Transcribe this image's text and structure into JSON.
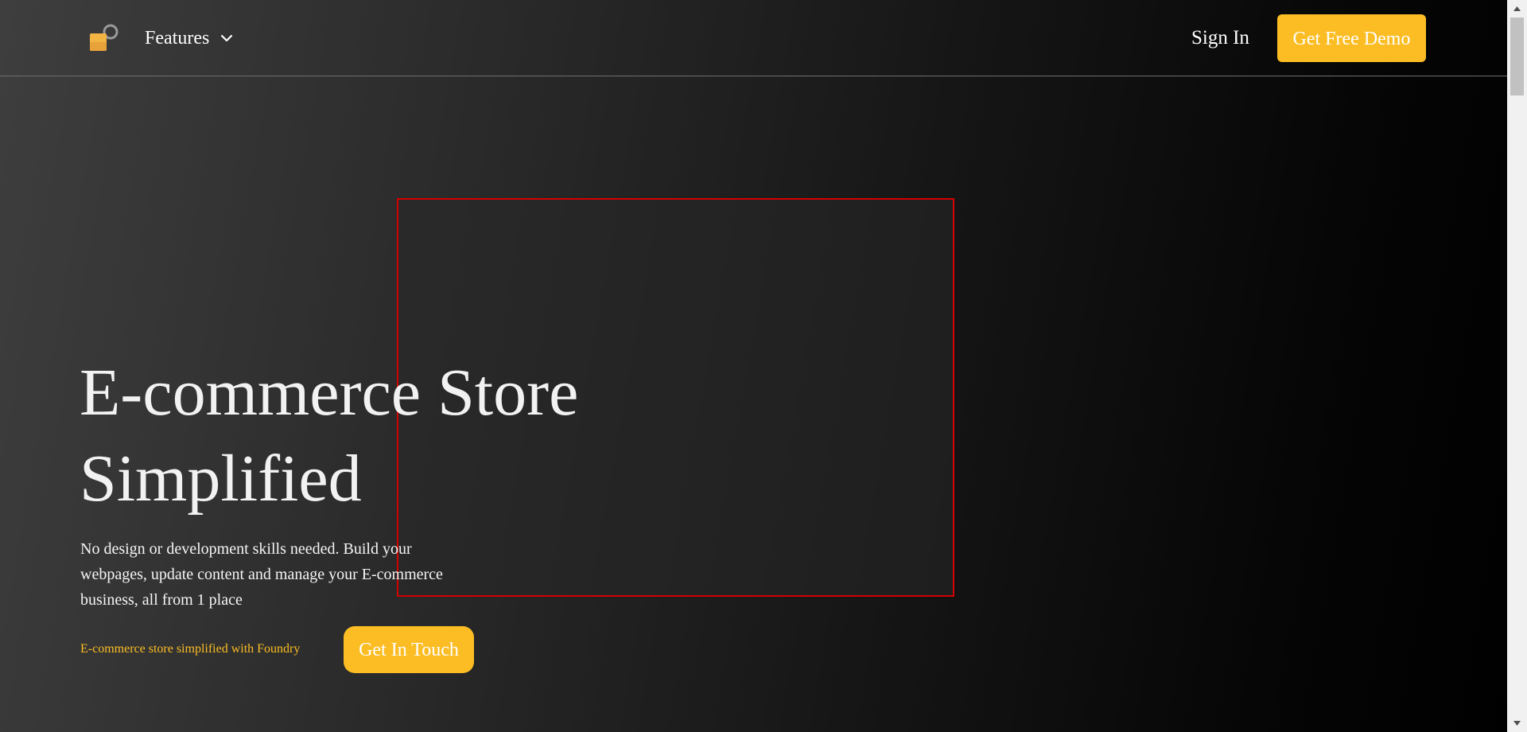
{
  "header": {
    "logo_icon": "lock-key-icon",
    "nav_features_label": "Features",
    "nav_features_icon": "chevron-down-icon",
    "signin_label": "Sign In",
    "demo_button_label": "Get Free Demo"
  },
  "hero": {
    "title": "E-commerce Store Simplified",
    "description": "No design or development skills needed. Build your webpages, update content and manage your E-commerce business, all from 1 place",
    "tagline": "E-commerce store simplified with Foundry",
    "cta_label": "Get In Touch"
  },
  "colors": {
    "accent": "#fbbd23",
    "selection_border": "#d40000",
    "text": "#ffffff"
  }
}
